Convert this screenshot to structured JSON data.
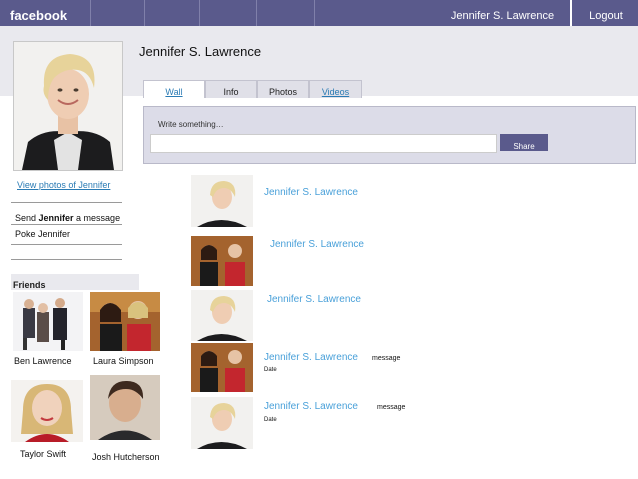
{
  "topbar": {
    "logo": "facebook",
    "user": "Jennifer S. Lawrence",
    "logout": "Logout"
  },
  "profile": {
    "name": "Jennifer S. Lawrence"
  },
  "tabs": [
    {
      "label": "Wall"
    },
    {
      "label": "Info"
    },
    {
      "label": "Photos"
    },
    {
      "label": "Videos"
    }
  ],
  "composer": {
    "prompt": "Write something…",
    "share": "Share"
  },
  "sidebar": {
    "view_photos": "View photos of Jennifer",
    "send_prefix": "Send ",
    "send_name": "Jennifer",
    "send_suffix": " a message",
    "poke": "Poke Jennifer",
    "friends_heading": "Friends",
    "friends": [
      {
        "name": "Ben Lawrence"
      },
      {
        "name": "Laura Simpson"
      },
      {
        "name": "Taylor Swift"
      },
      {
        "name": "Josh Hutcherson"
      }
    ]
  },
  "feed": [
    {
      "name": "Jennifer S. Lawrence",
      "message": "",
      "date": ""
    },
    {
      "name": "Jennifer S. Lawrence",
      "message": "",
      "date": ""
    },
    {
      "name": "Jennifer S. Lawrence",
      "message": "",
      "date": ""
    },
    {
      "name": "Jennifer S. Lawrence",
      "message": "message",
      "date": "Date"
    },
    {
      "name": "Jennifer S. Lawrence",
      "message": "message",
      "date": "Date"
    }
  ]
}
